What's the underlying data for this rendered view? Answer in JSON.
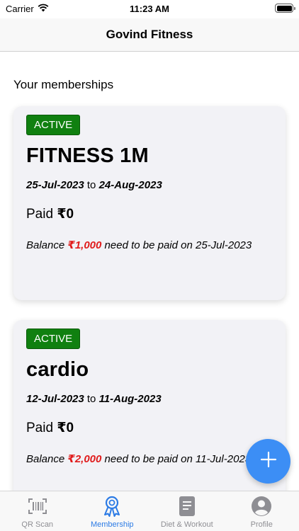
{
  "status_bar": {
    "carrier": "Carrier",
    "time": "11:23 AM"
  },
  "header": {
    "title": "Govind Fitness"
  },
  "main": {
    "section_title": "Your memberships",
    "memberships": [
      {
        "status": "ACTIVE",
        "name": "FITNESS 1M",
        "start_date": "25-Jul-2023",
        "date_separator": "to",
        "end_date": "24-Aug-2023",
        "paid_label": "Paid",
        "paid_amount": "₹0",
        "balance_label": "Balance",
        "balance_amount": "₹1,000",
        "balance_text": "need to be paid on 25-Jul-2023"
      },
      {
        "status": "ACTIVE",
        "name": "cardio",
        "start_date": "12-Jul-2023",
        "date_separator": "to",
        "end_date": "11-Aug-2023",
        "paid_label": "Paid",
        "paid_amount": "₹0",
        "balance_label": "Balance",
        "balance_amount": "₹2,000",
        "balance_text": "need to be paid on 11-Jul-2023"
      }
    ]
  },
  "fab": {
    "icon": "plus-icon"
  },
  "tabs": [
    {
      "label": "QR Scan",
      "icon": "barcode-icon",
      "active": false
    },
    {
      "label": "Membership",
      "icon": "membership-badge-icon",
      "active": true
    },
    {
      "label": "Diet & Workout",
      "icon": "document-icon",
      "active": false
    },
    {
      "label": "Profile",
      "icon": "profile-icon",
      "active": false
    }
  ],
  "colors": {
    "accent": "#2c7be5",
    "fab": "#3c8ef5",
    "active_badge": "#108010",
    "balance_amount": "#e01b1b",
    "inactive_tab": "#8e8e93"
  }
}
